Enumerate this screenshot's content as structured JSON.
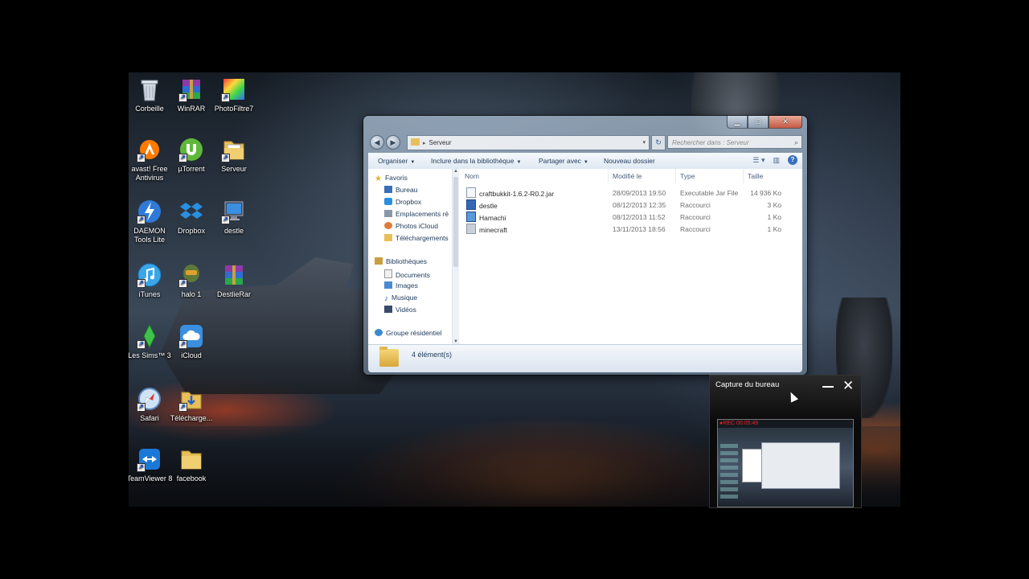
{
  "desktop_icons": [
    {
      "label": "Corbeille",
      "icon": "recycle-bin-icon"
    },
    {
      "label": "WinRAR",
      "icon": "winrar-icon"
    },
    {
      "label": "PhotoFiltre7",
      "icon": "photofiltre-icon"
    },
    {
      "label": "avast! Free Antivirus",
      "icon": "avast-icon"
    },
    {
      "label": "µTorrent",
      "icon": "utorrent-icon"
    },
    {
      "label": "Serveur",
      "icon": "folder-icon"
    },
    {
      "label": "DAEMON Tools Lite",
      "icon": "daemon-tools-icon"
    },
    {
      "label": "Dropbox",
      "icon": "dropbox-icon"
    },
    {
      "label": "destle",
      "icon": "computer-icon"
    },
    {
      "label": "iTunes",
      "icon": "itunes-icon"
    },
    {
      "label": "halo 1",
      "icon": "halo-icon"
    },
    {
      "label": "DestlieRar",
      "icon": "winrar-icon"
    },
    {
      "label": "Les Sims™ 3",
      "icon": "sims-icon"
    },
    {
      "label": "iCloud",
      "icon": "icloud-icon"
    },
    {
      "label": "Safari",
      "icon": "safari-icon"
    },
    {
      "label": "Télécharge...",
      "icon": "downloads-folder-icon"
    },
    {
      "label": "TeamViewer 8",
      "icon": "teamviewer-icon"
    },
    {
      "label": "facebook",
      "icon": "folder-icon"
    }
  ],
  "explorer": {
    "address": {
      "path": "Serveur"
    },
    "search": {
      "placeholder": "Rechercher dans : Serveur"
    },
    "toolbar": {
      "organize": "Organiser",
      "include_library": "Inclure dans la bibliothèque",
      "share_with": "Partager avec",
      "new_folder": "Nouveau dossier"
    },
    "nav": {
      "favorites": "Favoris",
      "favorites_items": [
        "Bureau",
        "Dropbox",
        "Emplacements ré",
        "Photos iCloud",
        "Téléchargements"
      ],
      "libraries": "Bibliothèques",
      "libraries_items": [
        "Documents",
        "Images",
        "Musique",
        "Vidéos"
      ],
      "homegroup": "Groupe résidentiel"
    },
    "columns": {
      "name": "Nom",
      "modified": "Modifié le",
      "type": "Type",
      "size": "Taille"
    },
    "files": [
      {
        "name": "craftbukkit-1.6.2-R0.2.jar",
        "modified": "28/09/2013 19:50",
        "type": "Executable Jar File",
        "size": "14 936 Ko",
        "icon": "jar-file-icon"
      },
      {
        "name": "destle",
        "modified": "08/12/2013 12:35",
        "type": "Raccourci",
        "size": "3 Ko",
        "icon": "shortcut-icon"
      },
      {
        "name": "Hamachi",
        "modified": "08/12/2013 11:52",
        "type": "Raccourci",
        "size": "1 Ko",
        "icon": "hamachi-icon"
      },
      {
        "name": "minecraft",
        "modified": "13/11/2013 18:56",
        "type": "Raccourci",
        "size": "1 Ko",
        "icon": "minecraft-icon"
      }
    ],
    "status": {
      "count": "4 élément(s)"
    }
  },
  "capture": {
    "title": "Capture du bureau",
    "rec": "●REC 00:05:49"
  },
  "colors": {
    "explorer_chrome": "#8fa1b4",
    "link_text": "#1e3a5a",
    "rec": "#e22222"
  }
}
